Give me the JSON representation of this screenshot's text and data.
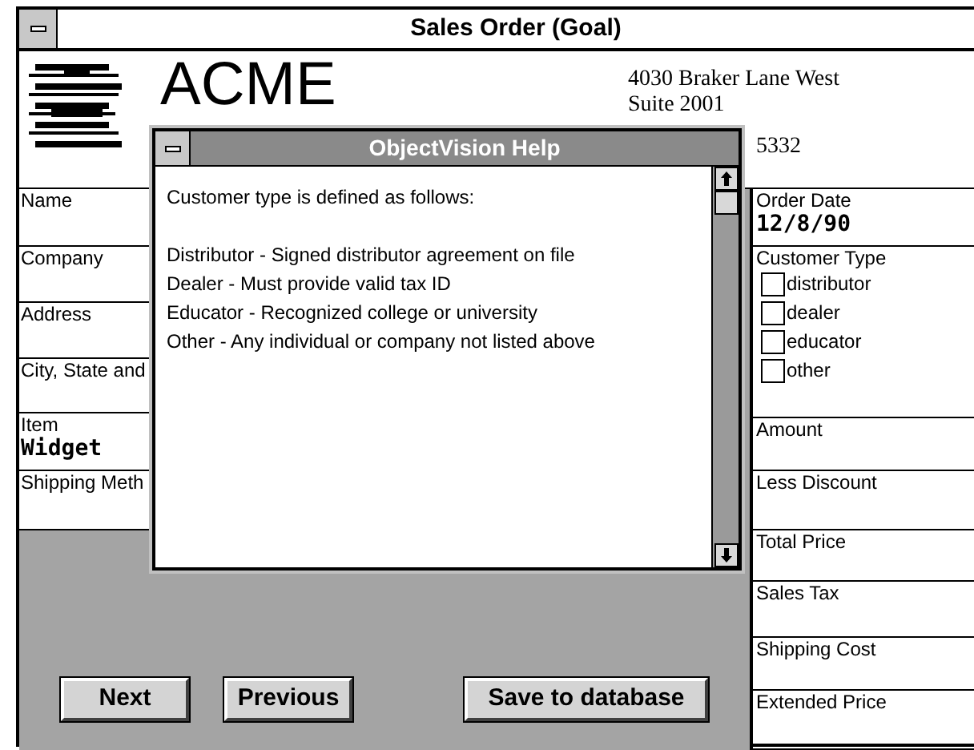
{
  "window": {
    "title": "Sales Order (Goal)"
  },
  "header": {
    "logo_text": "ACME",
    "address": [
      "4030 Braker Lane West",
      "Suite 2001",
      "5332"
    ]
  },
  "left_fields": [
    {
      "label": "Name"
    },
    {
      "label": "Company"
    },
    {
      "label": "Address"
    },
    {
      "label": "City, State and"
    },
    {
      "label": "Item",
      "value": "Widget"
    },
    {
      "label": "Shipping Meth"
    }
  ],
  "right_fields": [
    {
      "kind": "text",
      "label": "Order Date",
      "value": "12/8/90"
    },
    {
      "kind": "checkboxes",
      "label": "Customer Type",
      "options": [
        {
          "label": "distributor",
          "checked": false
        },
        {
          "label": "dealer",
          "checked": false
        },
        {
          "label": "educator",
          "checked": false
        },
        {
          "label": "other",
          "checked": false
        }
      ]
    },
    {
      "kind": "text",
      "label": "Amount"
    },
    {
      "kind": "text",
      "label": "Less Discount"
    },
    {
      "kind": "text",
      "label": "Total Price"
    },
    {
      "kind": "text",
      "label": "Sales Tax"
    },
    {
      "kind": "text",
      "label": "Shipping Cost"
    },
    {
      "kind": "text",
      "label": "Extended Price"
    }
  ],
  "buttons": [
    "Next",
    "Previous",
    "Save to database"
  ],
  "help_dialog": {
    "title": "ObjectVision Help",
    "intro": "Customer type is defined as follows:",
    "lines": [
      "Distributor - Signed distributor agreement on file",
      "Dealer - Must provide valid tax ID",
      "Educator - Recognized college or university",
      "Other - Any individual or company not listed above"
    ]
  }
}
